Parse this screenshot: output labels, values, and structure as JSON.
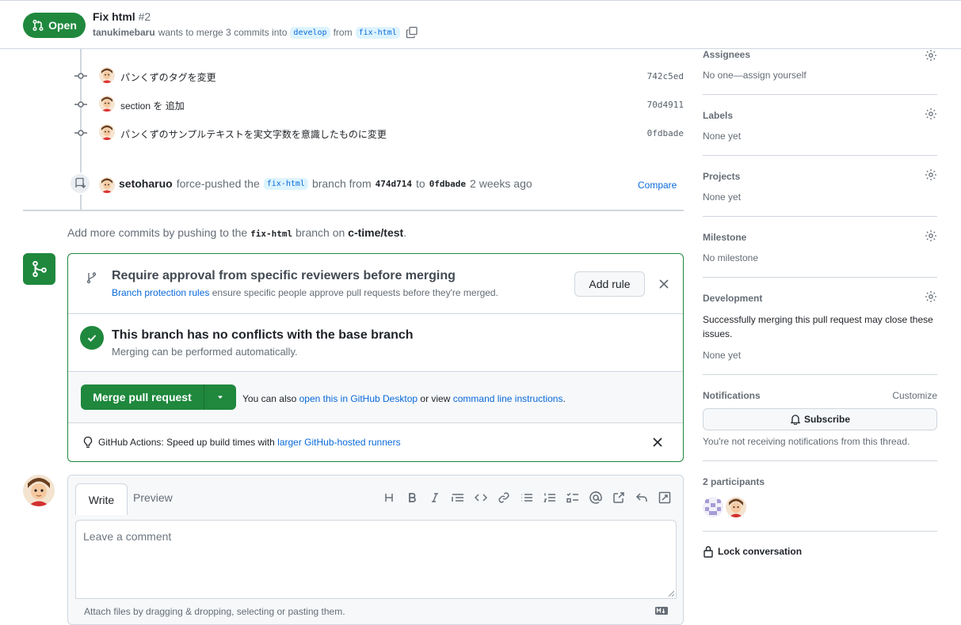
{
  "header": {
    "state": "Open",
    "title": "Fix html",
    "number": "#2",
    "author": "tanukimebaru",
    "merge_text": "wants to merge 3 commits into",
    "base_branch": "develop",
    "from_text": "from",
    "head_branch": "fix-html"
  },
  "commits": [
    {
      "message": "パンくずのタグを変更",
      "sha": "742c5ed"
    },
    {
      "message": "section を 追加",
      "sha": "70d4911"
    },
    {
      "message": "パンくずのサンプルテキストを実文字数を意識したものに変更",
      "sha": "0fdbade"
    }
  ],
  "force_push": {
    "actor": "setoharuo",
    "text1": "force-pushed the",
    "branch": "fix-html",
    "text2": "branch from",
    "from_sha": "474d714",
    "text3": "to",
    "to_sha": "0fdbade",
    "time": "2 weeks ago",
    "compare": "Compare"
  },
  "add_more": {
    "text1": "Add more commits by pushing to the",
    "branch": "fix-html",
    "text2": "branch on",
    "repo": "c-time/test",
    "period": "."
  },
  "merge_box": {
    "rule_title": "Require approval from specific reviewers before merging",
    "rule_link": "Branch protection rules",
    "rule_text": "ensure specific people approve pull requests before they're merged.",
    "add_rule": "Add rule",
    "no_conflicts_title": "This branch has no conflicts with the base branch",
    "no_conflicts_sub": "Merging can be performed automatically.",
    "merge_button": "Merge pull request",
    "alt_text1": "You can also",
    "alt_link1": "open this in GitHub Desktop",
    "alt_text2": "or view",
    "alt_link2": "command line instructions",
    "alt_period": ".",
    "actions_label": "GitHub Actions:",
    "actions_text": "Speed up build times with",
    "actions_link": "larger GitHub-hosted runners"
  },
  "composer": {
    "tab_write": "Write",
    "tab_preview": "Preview",
    "placeholder": "Leave a comment",
    "attach": "Attach files by dragging & dropping, selecting or pasting them."
  },
  "sidebar": {
    "assignees": {
      "label": "Assignees",
      "value": "No one—assign yourself"
    },
    "labels": {
      "label": "Labels",
      "value": "None yet"
    },
    "projects": {
      "label": "Projects",
      "value": "None yet"
    },
    "milestone": {
      "label": "Milestone",
      "value": "No milestone"
    },
    "development": {
      "label": "Development",
      "text": "Successfully merging this pull request may close these issues.",
      "value": "None yet"
    },
    "notifications": {
      "label": "Notifications",
      "customize": "Customize",
      "subscribe": "Subscribe",
      "note": "You're not receiving notifications from this thread."
    },
    "participants": {
      "label": "2 participants"
    },
    "lock": "Lock conversation"
  },
  "colors": {
    "green": "#1f883d",
    "link": "#0969da",
    "border": "#d0d7de"
  }
}
